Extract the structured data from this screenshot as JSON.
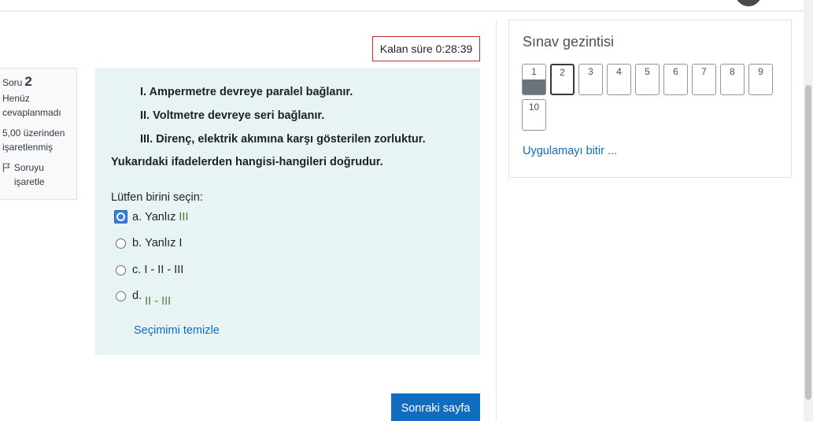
{
  "timer": {
    "text": "Kalan süre 0:28:39"
  },
  "question_info": {
    "label": "Soru",
    "number": "2",
    "state": "Henüz cevaplanmadı",
    "grade": "5,00 üzerinden işaretlenmiş",
    "flag_label": "Soruyu işaretle"
  },
  "question": {
    "statements": [
      "I. Ampermetre devreye paralel bağlanır.",
      "II. Voltmetre devreye seri bağlanır.",
      "III. Direnç, elektrik akımına karşı gösterilen zorluktur."
    ],
    "question_text": "Yukarıdaki ifadelerden hangisi-hangileri doğrudur.",
    "prompt": "Lütfen birini seçin:",
    "options": [
      {
        "letter": "a.",
        "text": "Yanlız",
        "value": "III"
      },
      {
        "letter": "b.",
        "text": "Yanlız I"
      },
      {
        "letter": "c.",
        "text": "I - II - III"
      },
      {
        "letter": "d.",
        "value": "II - III"
      }
    ],
    "clear_label": "Seçimimi temizle"
  },
  "next_button": "Sonraki sayfa",
  "navigation": {
    "title": "Sınav gezintisi",
    "buttons": [
      "1",
      "2",
      "3",
      "4",
      "5",
      "6",
      "7",
      "8",
      "9",
      "10"
    ],
    "finish_label": "Uygulamayı bitir ..."
  },
  "colors": {
    "accent": "#0f6cbf",
    "question_bg": "#e7f3f5",
    "timer_border": "#c42c2c",
    "answered_fill": "#6a737b"
  }
}
